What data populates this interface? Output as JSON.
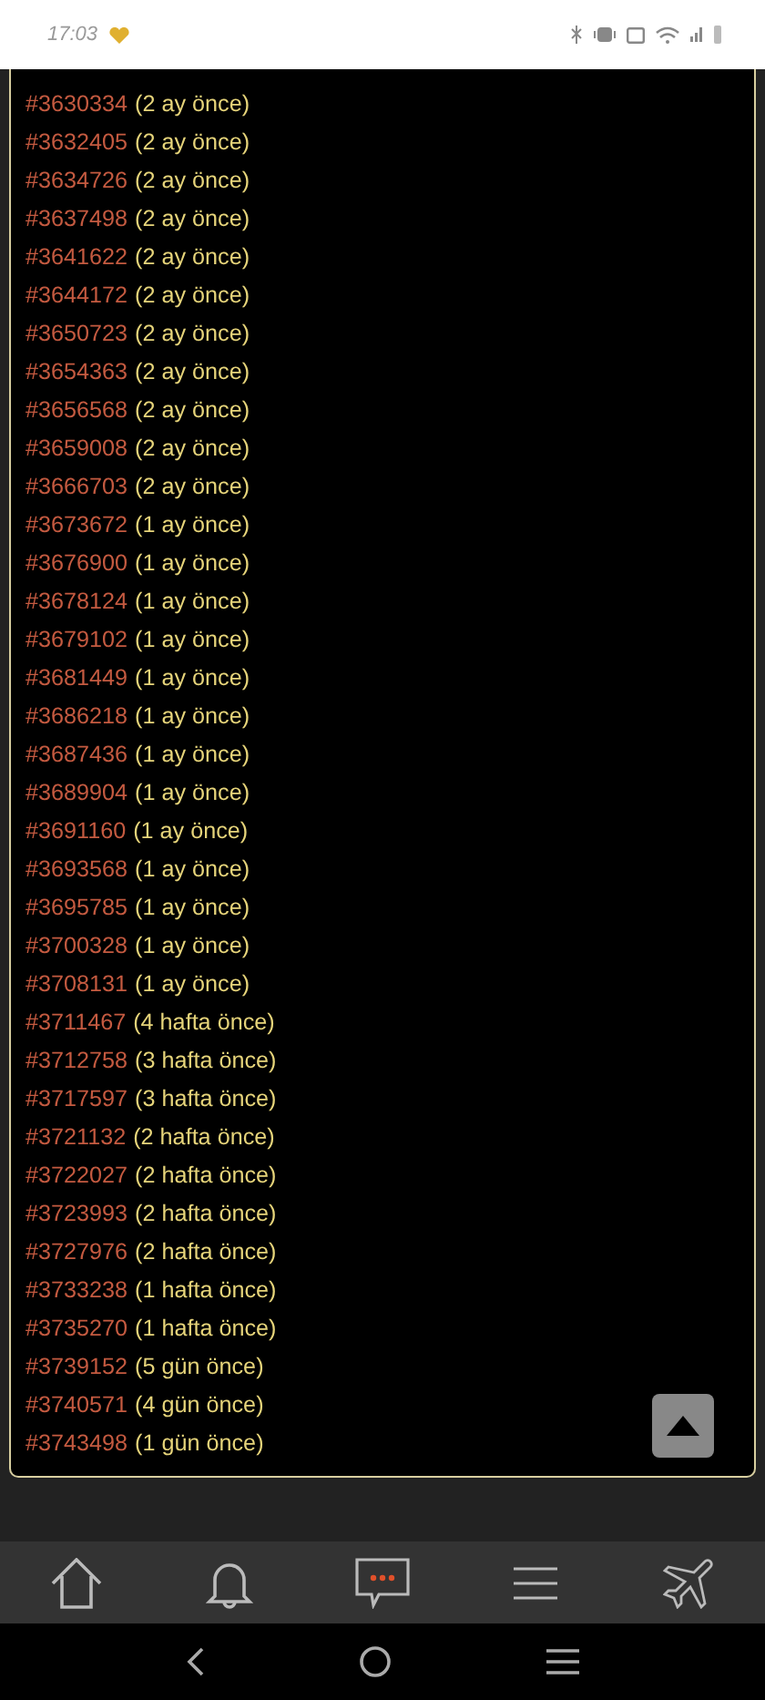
{
  "status_bar": {
    "time": "17:03"
  },
  "entries": [
    {
      "id": "#3630334",
      "age": "(2 ay önce)"
    },
    {
      "id": "#3632405",
      "age": "(2 ay önce)"
    },
    {
      "id": "#3634726",
      "age": "(2 ay önce)"
    },
    {
      "id": "#3637498",
      "age": "(2 ay önce)"
    },
    {
      "id": "#3641622",
      "age": "(2 ay önce)"
    },
    {
      "id": "#3644172",
      "age": "(2 ay önce)"
    },
    {
      "id": "#3650723",
      "age": "(2 ay önce)"
    },
    {
      "id": "#3654363",
      "age": "(2 ay önce)"
    },
    {
      "id": "#3656568",
      "age": "(2 ay önce)"
    },
    {
      "id": "#3659008",
      "age": "(2 ay önce)"
    },
    {
      "id": "#3666703",
      "age": "(2 ay önce)"
    },
    {
      "id": "#3673672",
      "age": "(1 ay önce)"
    },
    {
      "id": "#3676900",
      "age": "(1 ay önce)"
    },
    {
      "id": "#3678124",
      "age": "(1 ay önce)"
    },
    {
      "id": "#3679102",
      "age": "(1 ay önce)"
    },
    {
      "id": "#3681449",
      "age": "(1 ay önce)"
    },
    {
      "id": "#3686218",
      "age": "(1 ay önce)"
    },
    {
      "id": "#3687436",
      "age": "(1 ay önce)"
    },
    {
      "id": "#3689904",
      "age": "(1 ay önce)"
    },
    {
      "id": "#3691160",
      "age": "(1 ay önce)"
    },
    {
      "id": "#3693568",
      "age": "(1 ay önce)"
    },
    {
      "id": "#3695785",
      "age": "(1 ay önce)"
    },
    {
      "id": "#3700328",
      "age": "(1 ay önce)"
    },
    {
      "id": "#3708131",
      "age": "(1 ay önce)"
    },
    {
      "id": "#3711467",
      "age": "(4 hafta önce)"
    },
    {
      "id": "#3712758",
      "age": "(3 hafta önce)"
    },
    {
      "id": "#3717597",
      "age": "(3 hafta önce)"
    },
    {
      "id": "#3721132",
      "age": "(2 hafta önce)"
    },
    {
      "id": "#3722027",
      "age": "(2 hafta önce)"
    },
    {
      "id": "#3723993",
      "age": "(2 hafta önce)"
    },
    {
      "id": "#3727976",
      "age": "(2 hafta önce)"
    },
    {
      "id": "#3733238",
      "age": "(1 hafta önce)"
    },
    {
      "id": "#3735270",
      "age": "(1 hafta önce)"
    },
    {
      "id": "#3739152",
      "age": "(5 gün önce)"
    },
    {
      "id": "#3740571",
      "age": "(4 gün önce)"
    },
    {
      "id": "#3743498",
      "age": "(1 gün önce)"
    }
  ],
  "bottom_nav": [
    {
      "kind": "home"
    },
    {
      "kind": "bell"
    },
    {
      "kind": "messages"
    },
    {
      "kind": "menu"
    },
    {
      "kind": "plane"
    }
  ]
}
